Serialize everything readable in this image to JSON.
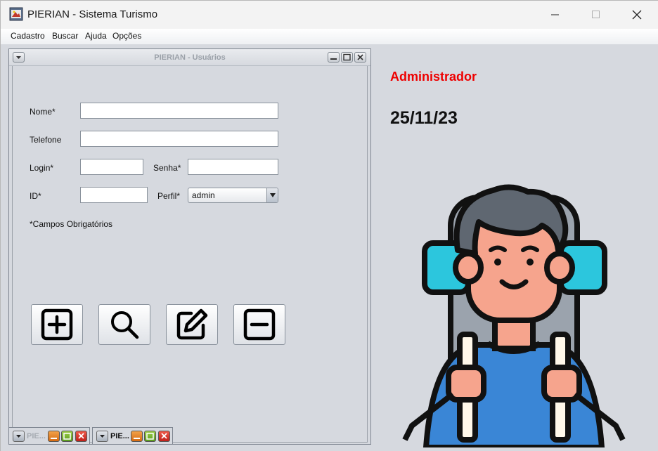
{
  "window": {
    "title": "PIERIAN - Sistema Turismo"
  },
  "menu": [
    "Cadastro",
    "Buscar",
    "Ajuda",
    "Opções"
  ],
  "internal_frame": {
    "title": "PIERIAN - Usuários",
    "form": {
      "nome_label": "Nome*",
      "nome_value": "",
      "telefone_label": "Telefone",
      "telefone_value": "",
      "login_label": "Login*",
      "login_value": "",
      "senha_label": "Senha*",
      "senha_value": "",
      "id_label": "ID*",
      "id_value": "",
      "perfil_label": "Perfil*",
      "perfil_value": "admin",
      "required_note": "*Campos Obrigatórios"
    },
    "actions": [
      {
        "icon": "add-icon"
      },
      {
        "icon": "search-icon"
      },
      {
        "icon": "edit-icon"
      },
      {
        "icon": "remove-icon"
      }
    ]
  },
  "status": {
    "user": "Administrador",
    "date": "25/11/23",
    "user_color": "#ee0000"
  },
  "minimized_frames": [
    {
      "title": "PIE..."
    },
    {
      "title": "PIE..."
    }
  ]
}
